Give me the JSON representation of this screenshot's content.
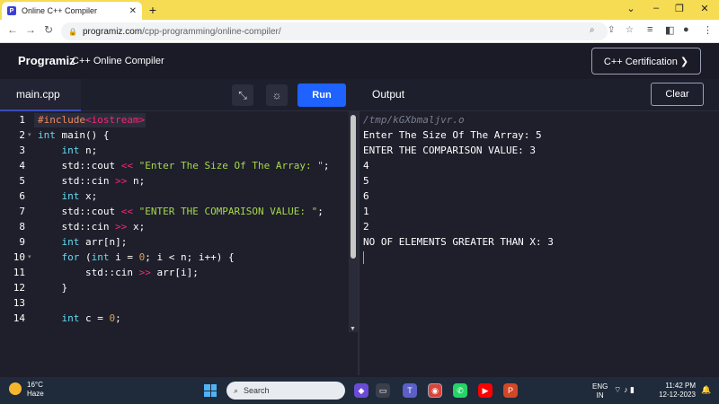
{
  "browser": {
    "tab_title": "Online C++ Compiler",
    "tab_close": "✕",
    "new_tab": "+",
    "url_host": "programiz.com",
    "url_path": "/cpp-programming/online-compiler/"
  },
  "site": {
    "logo": "Programiz",
    "title": "C++ Online Compiler",
    "cert_button": "C++ Certification ❯"
  },
  "toolbar": {
    "file_tab": "main.cpp",
    "run_label": "Run",
    "output_label": "Output",
    "clear_label": "Clear"
  },
  "editor": {
    "line_numbers": [
      "1",
      "2",
      "3",
      "4",
      "5",
      "6",
      "7",
      "8",
      "9",
      "10",
      "11",
      "12",
      "13",
      "14"
    ]
  },
  "output": {
    "path": "/tmp/kGXbmaljvr.o",
    "lines": [
      "Enter The Size Of The Array: 5",
      "ENTER THE COMPARISON VALUE: 3",
      "4",
      "5",
      "6",
      "1",
      "2",
      "NO OF ELEMENTS GREATER THAN X: 3"
    ]
  },
  "taskbar": {
    "temp": "16°C",
    "weather": "Haze",
    "search": "Search",
    "lang_1": "ENG",
    "lang_2": "IN",
    "time": "11:42 PM",
    "date": "12-12-2023"
  },
  "colors": {
    "tabbar": "#f5dc52",
    "run_button": "#1e62ff",
    "editor_bg": "#1e1f2b"
  }
}
